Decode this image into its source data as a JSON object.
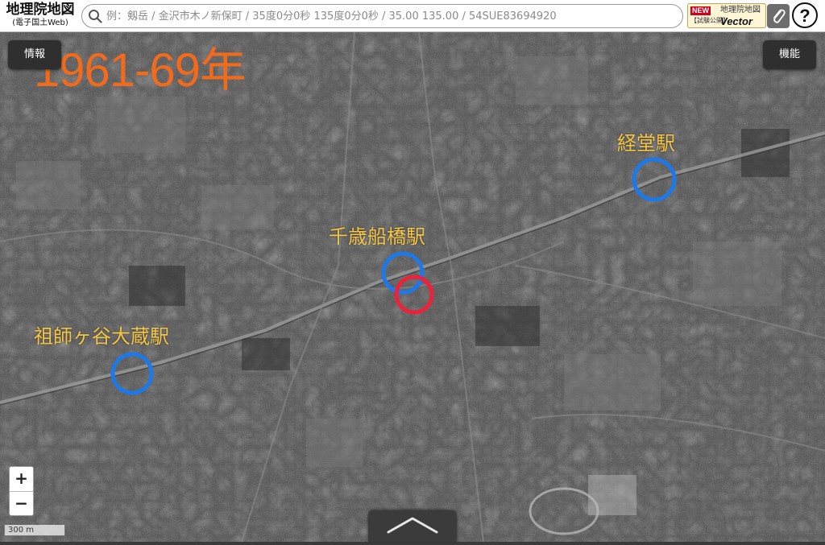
{
  "app": {
    "logo_main": "地理院地図",
    "logo_sub": "(電子国土Web)"
  },
  "search": {
    "placeholder": "例：剱岳 / 金沢市木ノ新保町 / 35度0分0秒 135度0分0秒 / 35.00 135.00 / 54SUE83694920"
  },
  "vector_banner": {
    "badge": "NEW",
    "trial": "【試験公開】",
    "title": "地理院地図",
    "word": "Vector"
  },
  "buttons": {
    "info": "情報",
    "functions": "機能",
    "help": "?",
    "zoom_in": "+",
    "zoom_out": "−"
  },
  "overlay": {
    "era": "1961-69年",
    "stations": {
      "kyodo": "経堂駅",
      "chitose_funabashi": "千歳船橋駅",
      "soshigaya_okura": "祖師ヶ谷大蔵駅"
    }
  },
  "scale_bar": {
    "label": "300 m"
  },
  "colors": {
    "era_text": "#f26b1d",
    "station_text": "#f5c544",
    "station_circle": "#1e78e6",
    "marker_circle": "#e8243c"
  }
}
